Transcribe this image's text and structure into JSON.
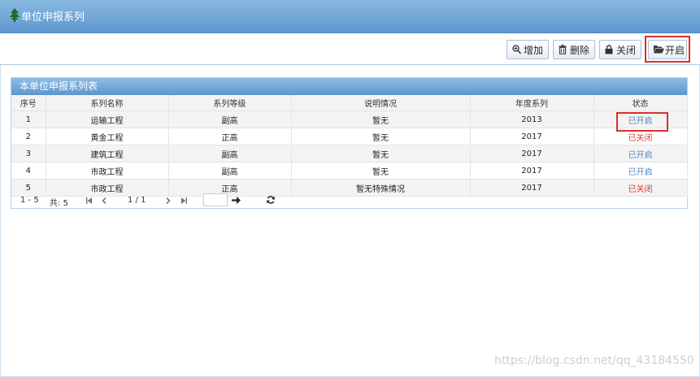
{
  "header": {
    "title": "单位申报系列",
    "icon": "tree-icon"
  },
  "toolbar": {
    "add_label": "增加",
    "delete_label": "删除",
    "close_label": "关闭",
    "open_label": "开启"
  },
  "panel": {
    "title": "本单位申报系列表"
  },
  "table": {
    "columns": [
      "序号",
      "系列名称",
      "系列等级",
      "说明情况",
      "年度系列",
      "状态"
    ],
    "rows": [
      {
        "no": "1",
        "name": "运输工程",
        "level": "副高",
        "desc": "暂无",
        "year": "2013",
        "status": "已开启"
      },
      {
        "no": "2",
        "name": "黄金工程",
        "level": "正高",
        "desc": "暂无",
        "year": "2017",
        "status": "已关闭"
      },
      {
        "no": "3",
        "name": "建筑工程",
        "level": "副高",
        "desc": "暂无",
        "year": "2017",
        "status": "已开启"
      },
      {
        "no": "4",
        "name": "市政工程",
        "level": "副高",
        "desc": "暂无",
        "year": "2017",
        "status": "已开启"
      },
      {
        "no": "5",
        "name": "市政工程",
        "level": "正高",
        "desc": "暂无特殊情况",
        "year": "2017",
        "status": "已关闭"
      }
    ]
  },
  "pager": {
    "range": "1 - 5",
    "total": "共: 5",
    "page": "1 / 1"
  },
  "watermark": "https://blog.csdn.net/qq_43184550",
  "colors": {
    "status_open": "#4f86c6",
    "status_closed": "#e23b3b",
    "highlight": "#d9302b",
    "header": "#6aa3d8"
  }
}
